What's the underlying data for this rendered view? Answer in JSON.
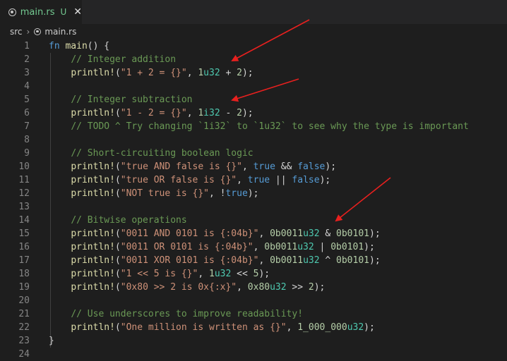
{
  "tab": {
    "filename": "main.rs",
    "status": "U",
    "close_glyph": "✕"
  },
  "breadcrumb": {
    "folder": "src",
    "separator": "›",
    "file": "main.rs"
  },
  "editor": {
    "lines": [
      {
        "n": "1",
        "tokens": [
          [
            "kw",
            "fn"
          ],
          [
            "pl",
            " "
          ],
          [
            "fn",
            "main"
          ],
          [
            "pl",
            "() {"
          ]
        ]
      },
      {
        "n": "2",
        "tokens": [
          [
            "pl",
            "    "
          ],
          [
            "cm",
            "// Integer addition"
          ]
        ]
      },
      {
        "n": "3",
        "tokens": [
          [
            "pl",
            "    "
          ],
          [
            "mac",
            "println!"
          ],
          [
            "pl",
            "("
          ],
          [
            "str",
            "\"1 + 2 = {}\""
          ],
          [
            "pl",
            ", "
          ],
          [
            "num",
            "1"
          ],
          [
            "ty",
            "u32"
          ],
          [
            "pl",
            " + "
          ],
          [
            "num",
            "2"
          ],
          [
            "pl",
            ");"
          ]
        ]
      },
      {
        "n": "4",
        "tokens": []
      },
      {
        "n": "5",
        "tokens": [
          [
            "pl",
            "    "
          ],
          [
            "cm",
            "// Integer subtraction"
          ]
        ]
      },
      {
        "n": "6",
        "tokens": [
          [
            "pl",
            "    "
          ],
          [
            "mac",
            "println!"
          ],
          [
            "pl",
            "("
          ],
          [
            "str",
            "\"1 - 2 = {}\""
          ],
          [
            "pl",
            ", "
          ],
          [
            "num",
            "1"
          ],
          [
            "ty",
            "i32"
          ],
          [
            "pl",
            " - "
          ],
          [
            "num",
            "2"
          ],
          [
            "pl",
            ");"
          ]
        ]
      },
      {
        "n": "7",
        "tokens": [
          [
            "pl",
            "    "
          ],
          [
            "cm",
            "// TODO ^ Try changing `1i32` to `1u32` to see why the type is important"
          ]
        ]
      },
      {
        "n": "8",
        "tokens": []
      },
      {
        "n": "9",
        "tokens": [
          [
            "pl",
            "    "
          ],
          [
            "cm",
            "// Short-circuiting boolean logic"
          ]
        ]
      },
      {
        "n": "10",
        "tokens": [
          [
            "pl",
            "    "
          ],
          [
            "mac",
            "println!"
          ],
          [
            "pl",
            "("
          ],
          [
            "str",
            "\"true AND false is {}\""
          ],
          [
            "pl",
            ", "
          ],
          [
            "kw",
            "true"
          ],
          [
            "pl",
            " && "
          ],
          [
            "kw",
            "false"
          ],
          [
            "pl",
            ");"
          ]
        ]
      },
      {
        "n": "11",
        "tokens": [
          [
            "pl",
            "    "
          ],
          [
            "mac",
            "println!"
          ],
          [
            "pl",
            "("
          ],
          [
            "str",
            "\"true OR false is {}\""
          ],
          [
            "pl",
            ", "
          ],
          [
            "kw",
            "true"
          ],
          [
            "pl",
            " || "
          ],
          [
            "kw",
            "false"
          ],
          [
            "pl",
            ");"
          ]
        ]
      },
      {
        "n": "12",
        "tokens": [
          [
            "pl",
            "    "
          ],
          [
            "mac",
            "println!"
          ],
          [
            "pl",
            "("
          ],
          [
            "str",
            "\"NOT true is {}\""
          ],
          [
            "pl",
            ", !"
          ],
          [
            "kw",
            "true"
          ],
          [
            "pl",
            ");"
          ]
        ]
      },
      {
        "n": "13",
        "tokens": []
      },
      {
        "n": "14",
        "tokens": [
          [
            "pl",
            "    "
          ],
          [
            "cm",
            "// Bitwise operations"
          ]
        ]
      },
      {
        "n": "15",
        "tokens": [
          [
            "pl",
            "    "
          ],
          [
            "mac",
            "println!"
          ],
          [
            "pl",
            "("
          ],
          [
            "str",
            "\"0011 AND 0101 is {:04b}\""
          ],
          [
            "pl",
            ", "
          ],
          [
            "num",
            "0b0011"
          ],
          [
            "ty",
            "u32"
          ],
          [
            "pl",
            " & "
          ],
          [
            "num",
            "0b0101"
          ],
          [
            "pl",
            ");"
          ]
        ]
      },
      {
        "n": "16",
        "tokens": [
          [
            "pl",
            "    "
          ],
          [
            "mac",
            "println!"
          ],
          [
            "pl",
            "("
          ],
          [
            "str",
            "\"0011 OR 0101 is {:04b}\""
          ],
          [
            "pl",
            ", "
          ],
          [
            "num",
            "0b0011"
          ],
          [
            "ty",
            "u32"
          ],
          [
            "pl",
            " | "
          ],
          [
            "num",
            "0b0101"
          ],
          [
            "pl",
            ");"
          ]
        ]
      },
      {
        "n": "17",
        "tokens": [
          [
            "pl",
            "    "
          ],
          [
            "mac",
            "println!"
          ],
          [
            "pl",
            "("
          ],
          [
            "str",
            "\"0011 XOR 0101 is {:04b}\""
          ],
          [
            "pl",
            ", "
          ],
          [
            "num",
            "0b0011"
          ],
          [
            "ty",
            "u32"
          ],
          [
            "pl",
            " ^ "
          ],
          [
            "num",
            "0b0101"
          ],
          [
            "pl",
            ");"
          ]
        ]
      },
      {
        "n": "18",
        "tokens": [
          [
            "pl",
            "    "
          ],
          [
            "mac",
            "println!"
          ],
          [
            "pl",
            "("
          ],
          [
            "str",
            "\"1 << 5 is {}\""
          ],
          [
            "pl",
            ", "
          ],
          [
            "num",
            "1"
          ],
          [
            "ty",
            "u32"
          ],
          [
            "pl",
            " << "
          ],
          [
            "num",
            "5"
          ],
          [
            "pl",
            ");"
          ]
        ]
      },
      {
        "n": "19",
        "tokens": [
          [
            "pl",
            "    "
          ],
          [
            "mac",
            "println!"
          ],
          [
            "pl",
            "("
          ],
          [
            "str",
            "\"0x80 >> 2 is 0x{:x}\""
          ],
          [
            "pl",
            ", "
          ],
          [
            "num",
            "0x80"
          ],
          [
            "ty",
            "u32"
          ],
          [
            "pl",
            " >> "
          ],
          [
            "num",
            "2"
          ],
          [
            "pl",
            ");"
          ]
        ]
      },
      {
        "n": "20",
        "tokens": []
      },
      {
        "n": "21",
        "tokens": [
          [
            "pl",
            "    "
          ],
          [
            "cm",
            "// Use underscores to improve readability!"
          ]
        ]
      },
      {
        "n": "22",
        "tokens": [
          [
            "pl",
            "    "
          ],
          [
            "mac",
            "println!"
          ],
          [
            "pl",
            "("
          ],
          [
            "str",
            "\"One million is written as {}\""
          ],
          [
            "pl",
            ", "
          ],
          [
            "num",
            "1_000_000"
          ],
          [
            "ty",
            "u32"
          ],
          [
            "pl",
            ");"
          ]
        ]
      },
      {
        "n": "23",
        "tokens": [
          [
            "pl",
            "}"
          ]
        ]
      },
      {
        "n": "24",
        "tokens": []
      }
    ]
  },
  "colors": {
    "background": "#1e1e1e",
    "tab_label": "#73c991",
    "annotation_arrow": "#e8201e"
  }
}
